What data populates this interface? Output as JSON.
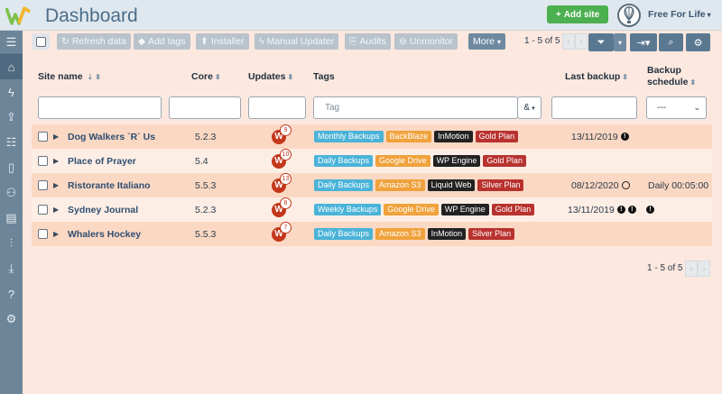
{
  "header": {
    "title": "Dashboard",
    "add_site": "Add site",
    "user": "Free For Life"
  },
  "sidebar": {
    "items": [
      "home-icon",
      "bolt-icon",
      "upload-icon",
      "list-icon",
      "bookmark-icon",
      "users-icon",
      "document-icon",
      "sliders-icon",
      "download-icon",
      "help-icon",
      "settings-icon"
    ]
  },
  "toolbar": {
    "refresh": "Refresh data",
    "add_tags": "Add tags",
    "installer": "Installer",
    "manual_updater": "Manual Updater",
    "audits": "Audits",
    "unmonitor": "Unmonitor",
    "more": "More",
    "pager": "1 - 5 of 5"
  },
  "table": {
    "headers": {
      "site_name": "Site name",
      "core": "Core",
      "updates": "Updates",
      "tags": "Tags",
      "last_backup": "Last backup",
      "backup_schedule_1": "Backup",
      "backup_schedule_2": "schedule"
    },
    "filters": {
      "tag_placeholder": "Tag",
      "tag_operator": "&",
      "schedule_value": "---"
    },
    "rows": [
      {
        "name": "Dog Walkers `R` Us",
        "core": "5.2.3",
        "updates": "9",
        "tags": [
          [
            "Monthly Backups",
            "#4ab3d8"
          ],
          [
            "BackBlaze",
            "#f0a23c"
          ],
          [
            "InMotion",
            "#222222"
          ],
          [
            "Gold Plan",
            "#b8322f"
          ]
        ],
        "last_backup": "13/11/2019",
        "schedule": ""
      },
      {
        "name": "Place of Prayer",
        "core": "5.4",
        "updates": "10",
        "tags": [
          [
            "Daily Backups",
            "#4ab3d8"
          ],
          [
            "Google Drive",
            "#f0a23c"
          ],
          [
            "WP Engine",
            "#222222"
          ],
          [
            "Gold Plan",
            "#b8322f"
          ]
        ],
        "last_backup": "",
        "schedule": ""
      },
      {
        "name": "Ristorante Italiano",
        "core": "5.5.3",
        "updates": "13",
        "tags": [
          [
            "Daily Backups",
            "#4ab3d8"
          ],
          [
            "Amazon S3",
            "#f0a23c"
          ],
          [
            "Liquid Web",
            "#222222"
          ],
          [
            "Silver Plan",
            "#b8322f"
          ]
        ],
        "last_backup": "08/12/2020",
        "schedule": "Daily 00:05:00"
      },
      {
        "name": "Sydney Journal",
        "core": "5.2.3",
        "updates": "8",
        "tags": [
          [
            "Weekly Backups",
            "#4ab3d8"
          ],
          [
            "Google Drive",
            "#f0a23c"
          ],
          [
            "WP Engine",
            "#222222"
          ],
          [
            "Gold Plan",
            "#b8322f"
          ]
        ],
        "last_backup": "13/11/2019",
        "schedule": ""
      },
      {
        "name": "Whalers Hockey",
        "core": "5.5.3",
        "updates": "7",
        "tags": [
          [
            "Daily Backups",
            "#4ab3d8"
          ],
          [
            "Amazon S3",
            "#f0a23c"
          ],
          [
            "InMotion",
            "#222222"
          ],
          [
            "Silver Plan",
            "#b8322f"
          ]
        ],
        "last_backup": "",
        "schedule": ""
      }
    ]
  },
  "footer": {
    "pager": "1 - 5 of 5"
  },
  "colors": {
    "accent": "#4caf50",
    "sidebar": "#6d8599",
    "header": "#dfe8ee",
    "page_bg": "#fce8df",
    "row_peach": "#fbd8c3",
    "row_light": "#fdeee5"
  }
}
